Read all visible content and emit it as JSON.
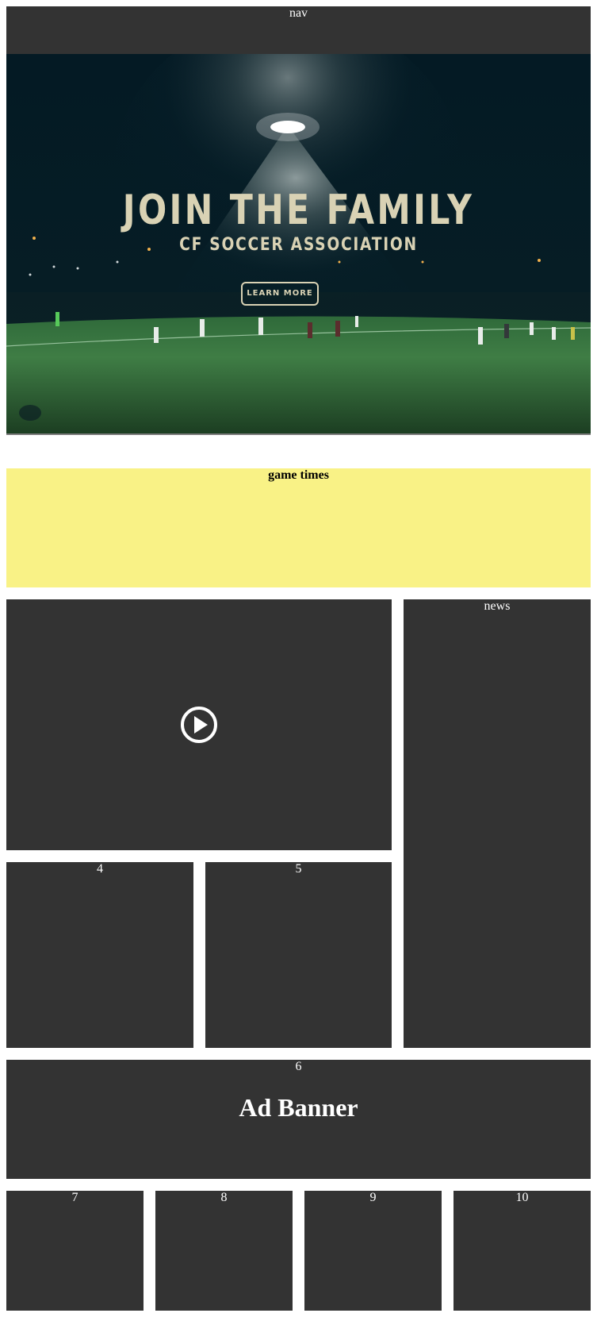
{
  "nav": {
    "label": "nav"
  },
  "hero": {
    "headline": "JOIN THE FAMILY",
    "subheadline": "CF SOCCER ASSOCIATION",
    "cta_label": "LEARN MORE"
  },
  "game_times": {
    "label": "game times"
  },
  "news": {
    "label": "news"
  },
  "boxes": {
    "b4": "4",
    "b5": "5",
    "b6": "6",
    "b7": "7",
    "b8": "8",
    "b9": "9",
    "b10": "10"
  },
  "ad": {
    "title": "Ad Banner"
  },
  "colors": {
    "box_bg": "#333333",
    "game_times_bg": "#f9f286",
    "hero_night": "#021a26",
    "hero_grass": "#2e6b35",
    "hero_text": "#d9d2b4"
  },
  "icons": {
    "video": "play-circle-icon"
  }
}
